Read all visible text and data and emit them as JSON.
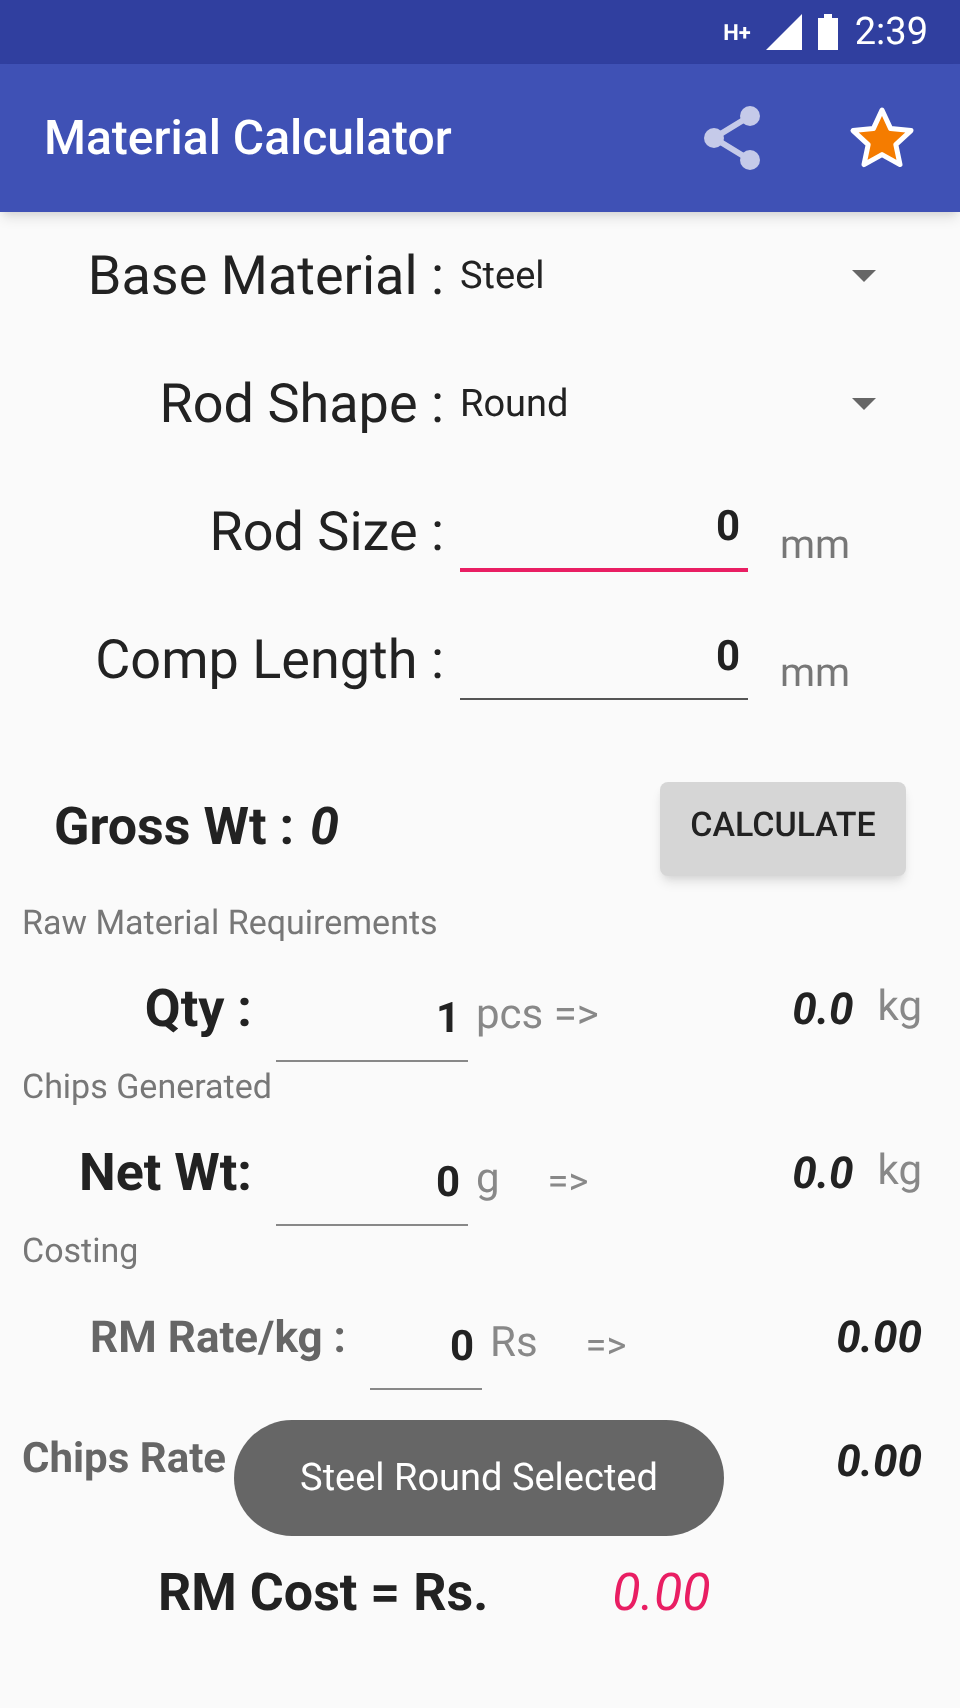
{
  "status_bar": {
    "network": "H+",
    "time": "2:39"
  },
  "app_bar": {
    "title": "Material Calculator"
  },
  "selectors": [
    {
      "label": "Base Material :",
      "value": "Steel"
    },
    {
      "label": "Rod Shape :",
      "value": "Round"
    }
  ],
  "inputs": [
    {
      "label": "Rod Size :",
      "value": "0",
      "unit": "mm",
      "focused": true
    },
    {
      "label": "Comp Length :",
      "value": "0",
      "unit": "mm",
      "focused": false
    }
  ],
  "gross": {
    "label": "Gross Wt :",
    "value": "0"
  },
  "calculate_button": "CALCULATE",
  "sections": [
    {
      "title": "Raw Material Requirements",
      "rows": [
        {
          "label": "Qty :",
          "value": "1",
          "unit": "pcs =>",
          "result": "0.0",
          "result_unit": "kg"
        }
      ]
    },
    {
      "title": "Chips Generated",
      "rows": [
        {
          "label": "Net Wt:",
          "value": "0",
          "unit": "g",
          "arrow": "=>",
          "result": "0.0",
          "result_unit": "kg"
        }
      ]
    },
    {
      "title": "Costing",
      "rows": [
        {
          "label": "RM Rate/kg :",
          "value": "0",
          "unit": "Rs",
          "arrow": "=>",
          "result": "0.00"
        },
        {
          "label": "Chips Rate",
          "result": "0.00"
        }
      ]
    }
  ],
  "total": {
    "label": "RM Cost = Rs.",
    "value": "0.00"
  },
  "toast": "Steel Round Selected"
}
